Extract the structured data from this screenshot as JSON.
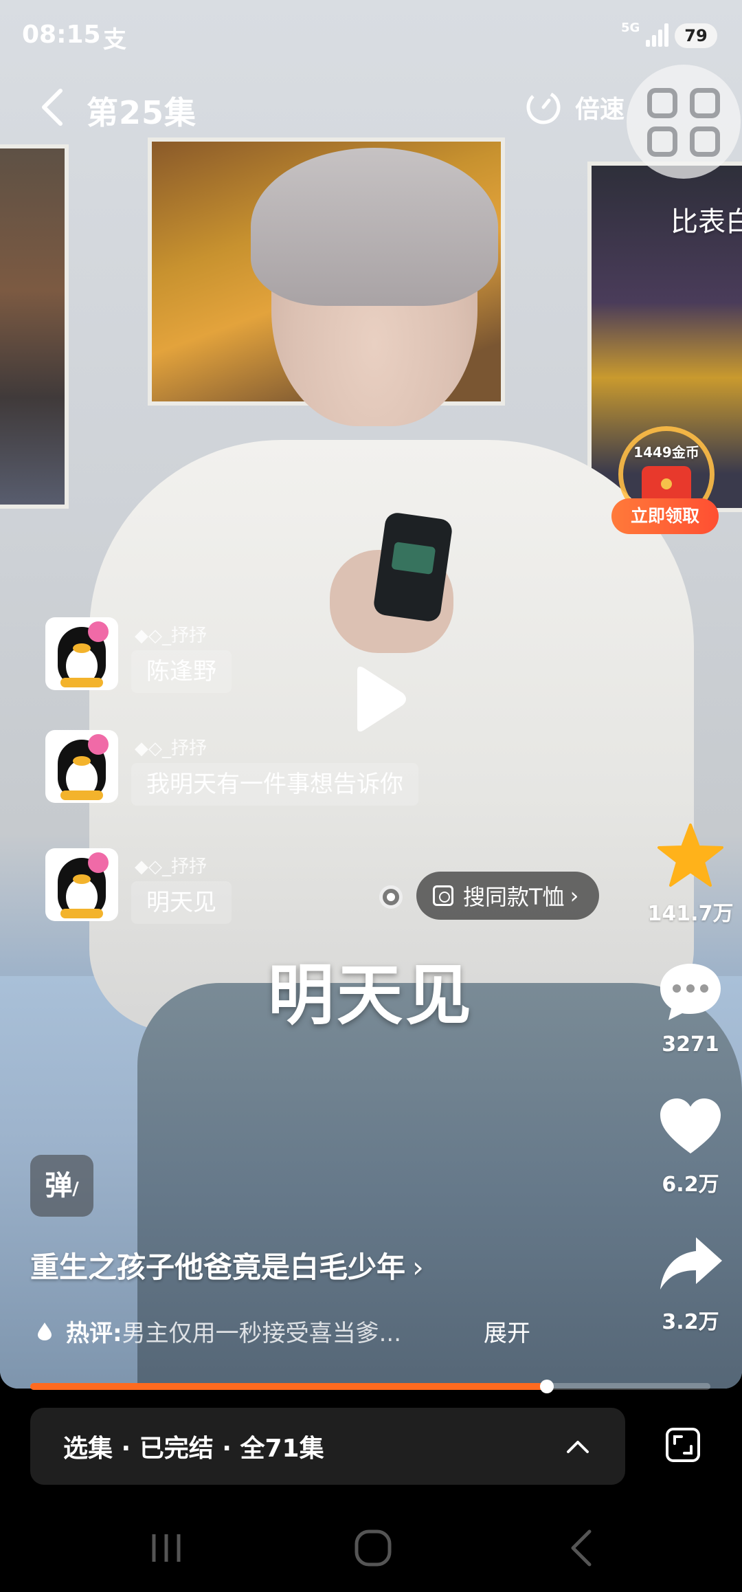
{
  "status": {
    "time": "08:15",
    "alipay_glyph": "支",
    "network": "5G",
    "battery": "79"
  },
  "header": {
    "episode_title": "第25集",
    "speed_label": "倍速",
    "side_hint": "比表白"
  },
  "reward": {
    "amount": "1449金币",
    "claim_label": "立即领取"
  },
  "chat": [
    {
      "name": "◆◇_抒抒",
      "message": "陈逢野"
    },
    {
      "name": "◆◇_抒抒",
      "message": "我明天有一件事想告诉你"
    },
    {
      "name": "◆◇_抒抒",
      "message": "明天见"
    }
  ],
  "product_tag": "搜同款T恤",
  "subtitle": "明天见",
  "actions": {
    "favorite_count": "141.7万",
    "comment_count": "3271",
    "like_count": "6.2万",
    "share_count": "3.2万"
  },
  "danmaku_label": "弹",
  "show": {
    "title": "重生之孩子他爸竟是白毛少年",
    "chevron": "›",
    "hot_label": "热评:",
    "hot_text": "男主仅用一秒接受喜当爹...",
    "expand_label": "展开"
  },
  "playback": {
    "progress": 0.76
  },
  "episode_bar": {
    "label": "选集 · 已完结 · 全71集"
  },
  "colors": {
    "accent": "#ff6a1f",
    "star": "#ffb21a",
    "claim": "#ff5a34"
  }
}
